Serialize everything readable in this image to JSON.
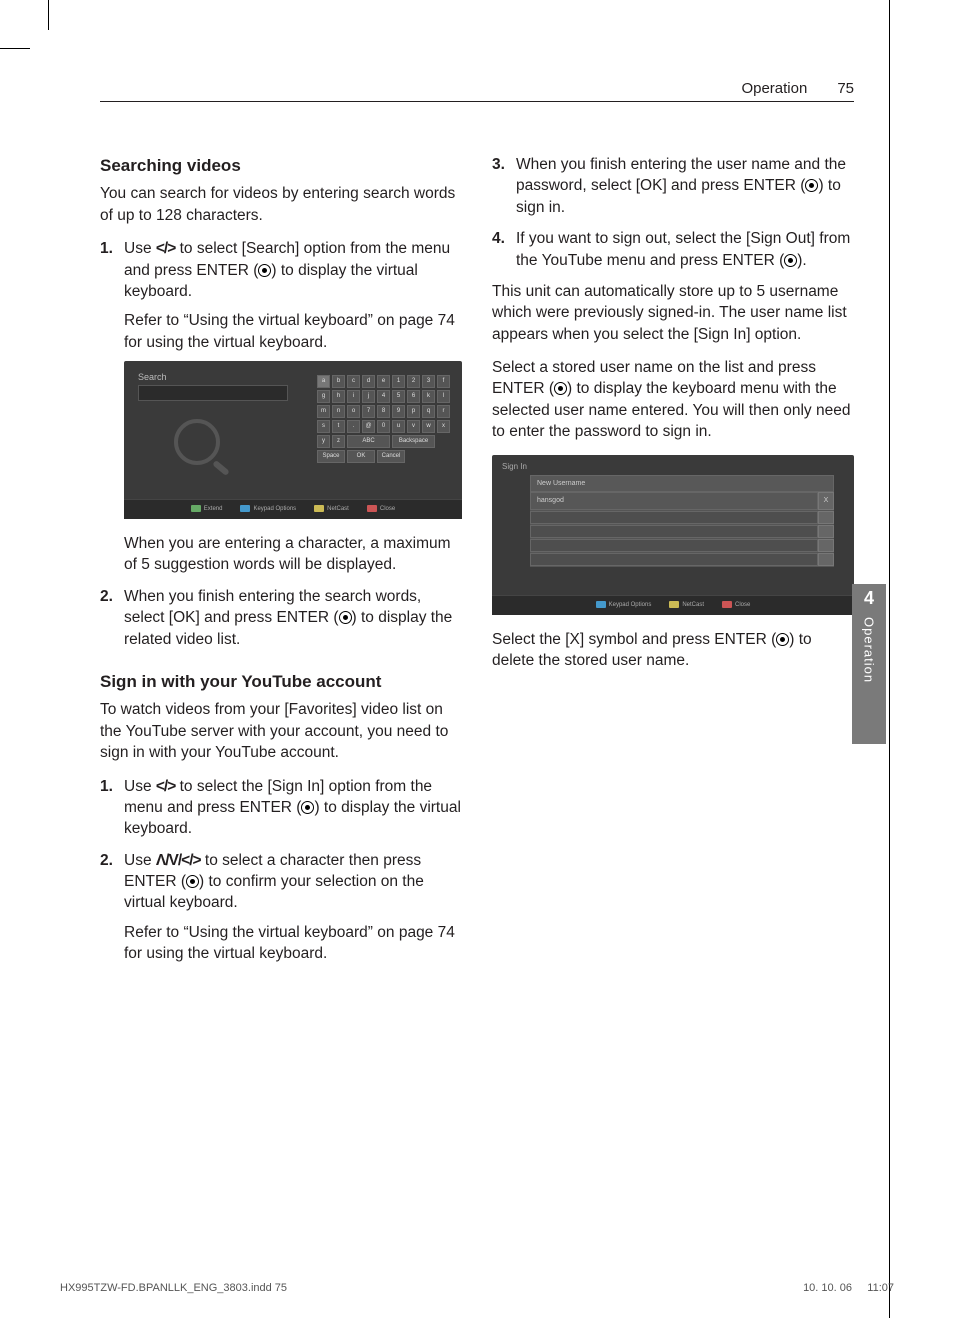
{
  "header": {
    "section": "Operation",
    "page": "75"
  },
  "side_tab": {
    "num": "4",
    "label": "Operation"
  },
  "left": {
    "h_search": "Searching videos",
    "p_search_intro": "You can search for videos by entering search words of up to 128 characters.",
    "steps_search": [
      {
        "num": "1.",
        "parts": [
          "Use ",
          "nav_lr",
          " to select [Search] option from the menu and press ENTER (",
          "enter",
          ") to display the virtual keyboard."
        ],
        "sub": "Refer to “Using the virtual keyboard” on page 74 for using the virtual keyboard."
      },
      {
        "num": "2.",
        "parts": [
          "When you finish entering the search words, select [OK] and press ENTER (",
          "enter",
          ") to display the related video list."
        ]
      }
    ],
    "p_after_mock1": "When you are entering a character, a maximum of 5 suggestion words will be displayed.",
    "h_signin": "Sign in with your YouTube account",
    "p_signin_intro": "To watch videos from your [Favorites] video list on the YouTube server with your account, you need to sign in with your YouTube account.",
    "steps_signin": [
      {
        "num": "1.",
        "parts": [
          "Use ",
          "nav_lr",
          " to select the [Sign In] option from the menu and press ENTER (",
          "enter",
          ") to display the virtual keyboard."
        ]
      },
      {
        "num": "2.",
        "parts": [
          "Use ",
          "nav_udlr",
          " to select a character then press ENTER (",
          "enter",
          ") to confirm your selection on the virtual keyboard."
        ],
        "sub": "Refer to “Using the virtual keyboard” on page 74 for using the virtual keyboard."
      }
    ]
  },
  "right": {
    "steps_cont": [
      {
        "num": "3.",
        "parts": [
          "When you finish entering the user name and the password, select [OK] and press ENTER (",
          "enter",
          ") to sign in."
        ]
      },
      {
        "num": "4.",
        "parts": [
          "If you want to sign out, select the [Sign Out] from the YouTube menu and press ENTER (",
          "enter",
          ")."
        ]
      }
    ],
    "p_store": "This unit can automatically store up to 5 username which were previously signed-in. The user name list appears when you select the [Sign In] option.",
    "p_select_prefix": "Select a stored user name on the list and press ENTER (",
    "p_select_suffix": ") to display the keyboard menu with the selected user name entered. You will then only need to enter the password to sign in.",
    "p_delete_prefix": "Select the [X] symbol and press ENTER (",
    "p_delete_suffix": ") to delete the stored user name."
  },
  "mock1": {
    "title": "Search",
    "keys": [
      "a",
      "b",
      "c",
      "d",
      "e",
      "1",
      "2",
      "3",
      "f",
      "g",
      "h",
      "i",
      "j",
      "4",
      "5",
      "6",
      "k",
      "l",
      "m",
      "n",
      "o",
      "7",
      "8",
      "9",
      "p",
      "q",
      "r",
      "s",
      "t",
      ".",
      "@",
      "0",
      "u",
      "v",
      "w",
      "x",
      "y",
      "z"
    ],
    "abc": "ABC",
    "bottom": {
      "back": "Backspace",
      "space": "Space",
      "ok": "OK",
      "cancel": "Cancel"
    },
    "hints": [
      "Extend",
      "Keypad Options",
      "NetCast",
      "Close"
    ]
  },
  "mock2": {
    "title": "Sign In",
    "new_user": "New Username",
    "row_user": "hansgod",
    "x": "X",
    "hints": [
      "Keypad Options",
      "NetCast",
      "Close"
    ]
  },
  "glyphs": {
    "lr": "</>",
    "udlr": "Λ/V/</>"
  },
  "imprint": {
    "file": "HX995TZW-FD.BPANLLK_ENG_3803.indd   75",
    "date": "10. 10. 06",
    "time": "11:07"
  }
}
